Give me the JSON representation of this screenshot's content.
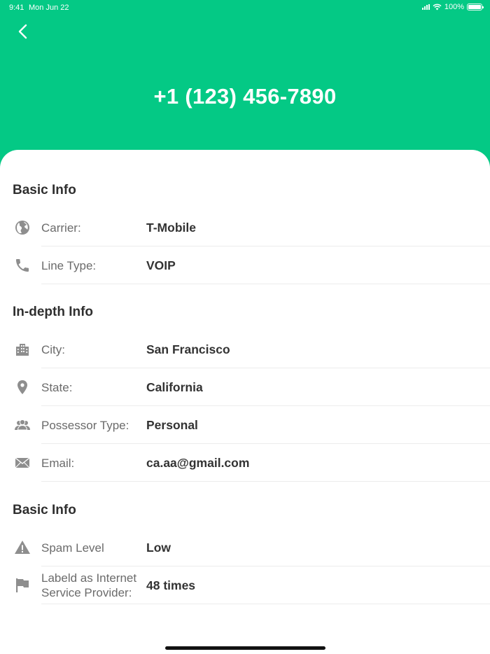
{
  "status_bar": {
    "time": "9:41",
    "date": "Mon Jun 22",
    "battery": "100%"
  },
  "header": {
    "phone_number": "+1 (123) 456-7890"
  },
  "basic_info": {
    "title": "Basic Info",
    "rows": [
      {
        "icon": "globe-icon",
        "label": "Carrier:",
        "value": "T-Mobile"
      },
      {
        "icon": "phone-icon",
        "label": "Line Type:",
        "value": "VOIP"
      }
    ]
  },
  "in_depth_info": {
    "title": "In-depth Info",
    "rows": [
      {
        "icon": "building-icon",
        "label": "City:",
        "value": "San Francisco"
      },
      {
        "icon": "location-pin-icon",
        "label": "State:",
        "value": "California"
      },
      {
        "icon": "people-icon",
        "label": "Possessor Type:",
        "value": "Personal"
      },
      {
        "icon": "envelope-icon",
        "label": "Email:",
        "value": "ca.aa@gmail.com"
      }
    ]
  },
  "spam_info": {
    "title": "Basic Info",
    "rows": [
      {
        "icon": "warning-icon",
        "label": "Spam Level",
        "value": "Low"
      },
      {
        "icon": "flag-icon",
        "label": "Labeld as Internet Service Provider:",
        "value": "48 times"
      }
    ]
  },
  "colors": {
    "accent": "#04c985",
    "icon": "#8e8e8e",
    "text": "#333333"
  }
}
